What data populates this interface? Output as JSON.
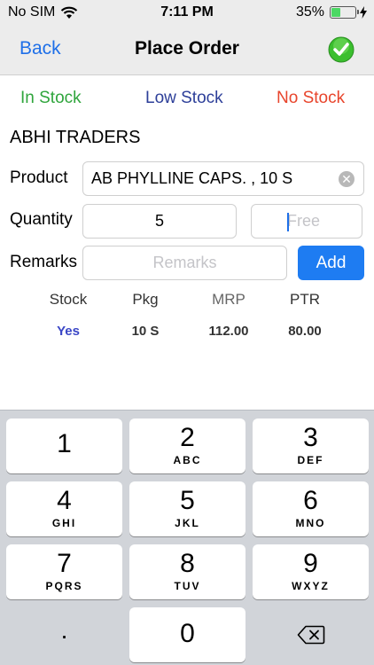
{
  "status": {
    "carrier": "No SIM",
    "time": "7:11 PM",
    "battery": "35%",
    "battery_level": 0.35
  },
  "nav": {
    "back": "Back",
    "title": "Place Order"
  },
  "legend": {
    "in_stock": "In Stock",
    "low_stock": "Low Stock",
    "no_stock": "No Stock"
  },
  "colors": {
    "in_stock": "#2fa53c",
    "low_stock": "#2d3f99",
    "no_stock": "#e8452c",
    "accent": "#1e7cf2"
  },
  "customer": "ABHI TRADERS",
  "form": {
    "product_label": "Product",
    "product_value": "AB PHYLLINE CAPS. , 10 S",
    "quantity_label": "Quantity",
    "quantity_value": "5",
    "free_placeholder": "Free",
    "remarks_label": "Remarks",
    "remarks_placeholder": "Remarks",
    "add_label": "Add"
  },
  "details": {
    "headers": [
      "Stock",
      "Pkg",
      "MRP",
      "PTR"
    ],
    "values": [
      "Yes",
      "10 S",
      "112.00",
      "80.00"
    ]
  },
  "keypad": {
    "keys": [
      {
        "num": "1",
        "letters": ""
      },
      {
        "num": "2",
        "letters": "ABC"
      },
      {
        "num": "3",
        "letters": "DEF"
      },
      {
        "num": "4",
        "letters": "GHI"
      },
      {
        "num": "5",
        "letters": "JKL"
      },
      {
        "num": "6",
        "letters": "MNO"
      },
      {
        "num": "7",
        "letters": "PQRS"
      },
      {
        "num": "8",
        "letters": "TUV"
      },
      {
        "num": "9",
        "letters": "WXYZ"
      },
      {
        "num": "0",
        "letters": ""
      }
    ],
    "dot": "."
  }
}
